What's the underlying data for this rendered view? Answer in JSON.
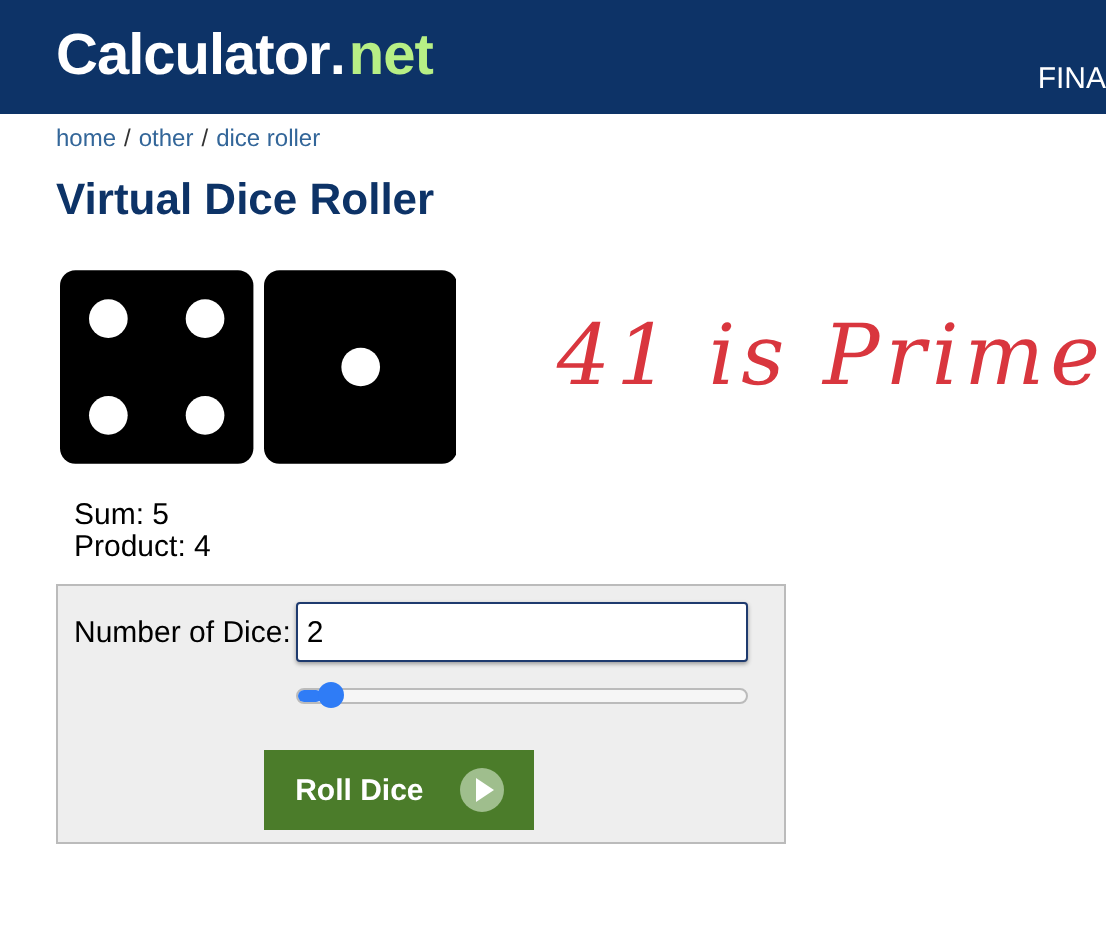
{
  "header": {
    "logo": {
      "main": "Calculator",
      "dot": ".",
      "suffix": "net"
    },
    "nav_item": "FINA"
  },
  "breadcrumb": [
    {
      "label": "home"
    },
    {
      "label": "other"
    },
    {
      "label": "dice roller"
    }
  ],
  "breadcrumb_separator": "/",
  "title": "Virtual Dice Roller",
  "dice": [
    {
      "kind": "four"
    },
    {
      "kind": "one"
    }
  ],
  "handwritten_note": "41 is Prime",
  "results": [
    "Sum: 5",
    "Product: 4"
  ],
  "form": {
    "label": "Number of Dice:",
    "value": "2",
    "slider": {
      "level": 0.05
    },
    "button": "Roll Dice"
  }
}
